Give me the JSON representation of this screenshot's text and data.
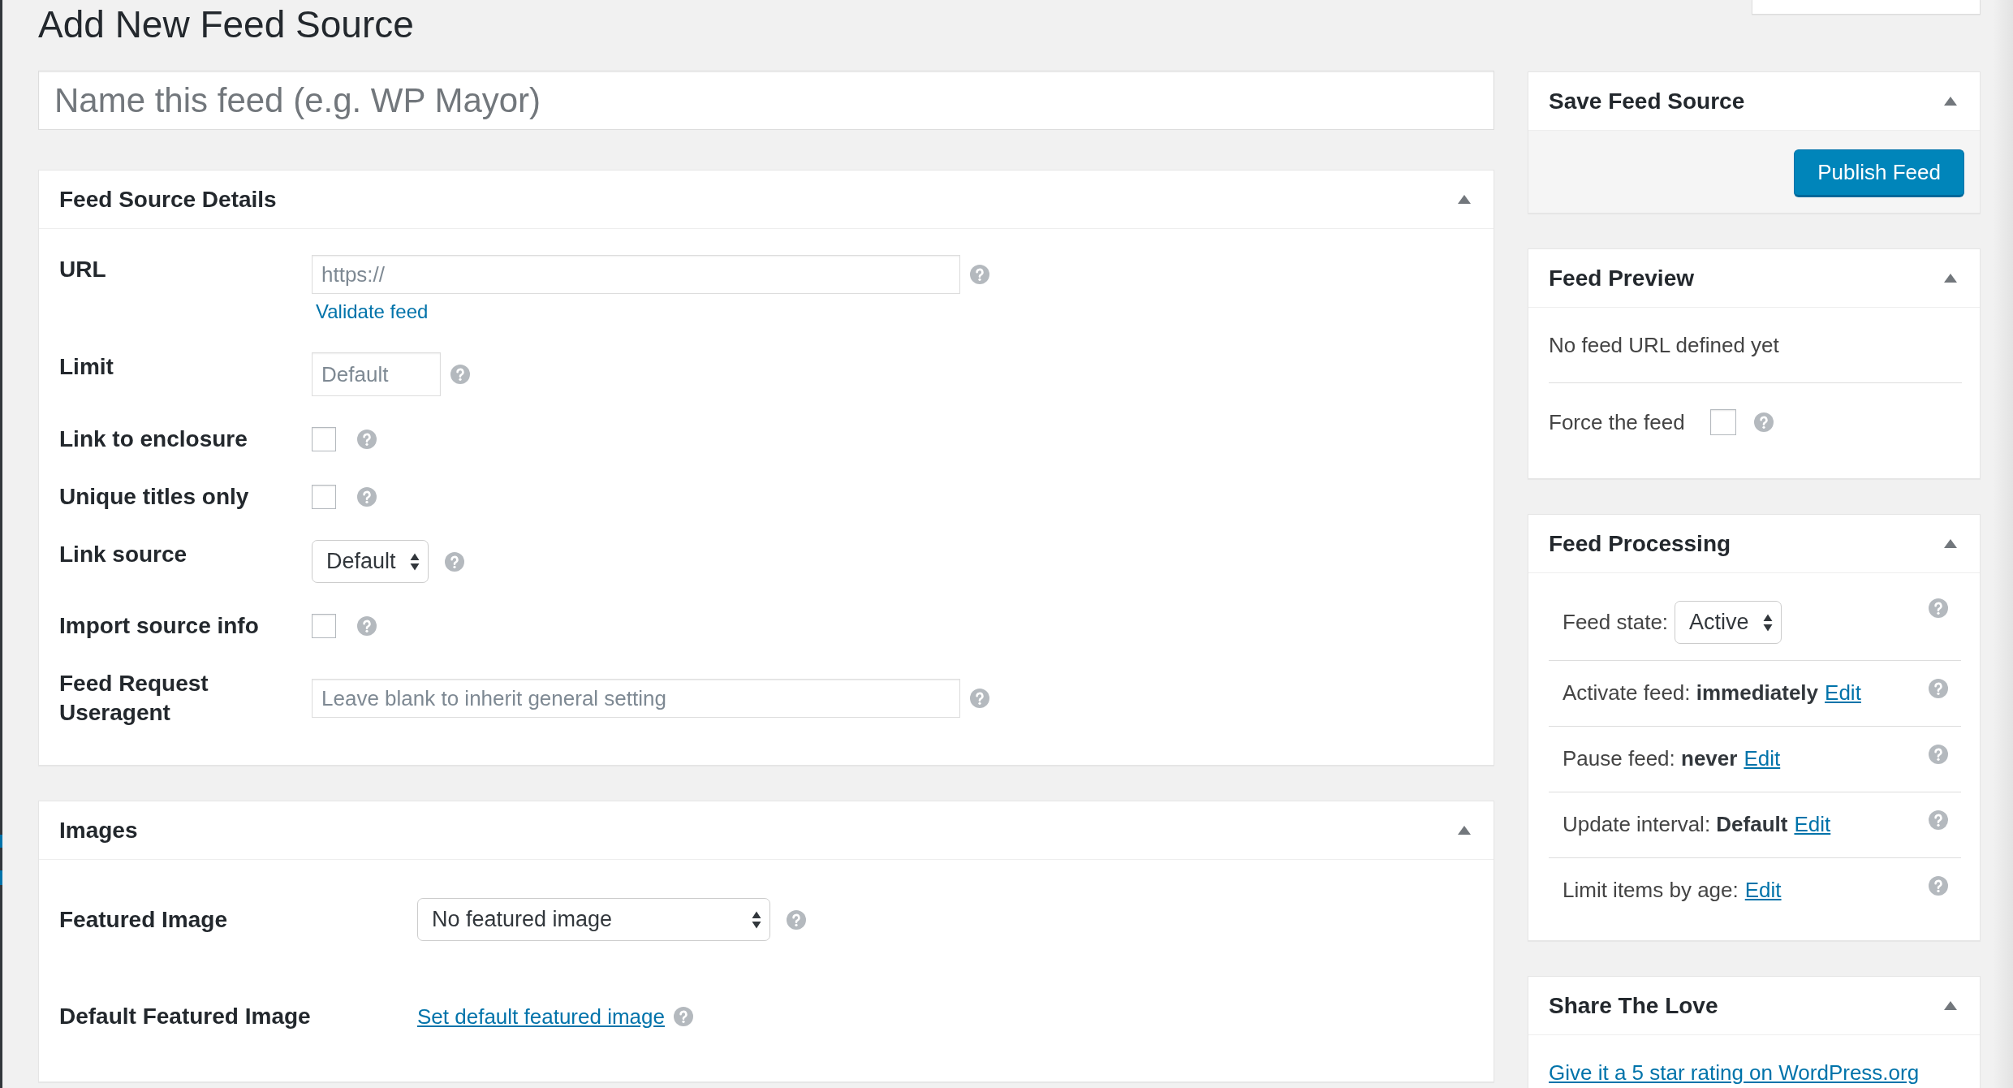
{
  "page_title": "Add New Feed Source",
  "title_field": {
    "placeholder": "Name this feed (e.g. WP Mayor)"
  },
  "main_boxes": [
    {
      "title": "Feed Source Details",
      "fields": [
        {
          "kind": "text",
          "label": "URL",
          "placeholder": "https://",
          "link": "Validate feed"
        },
        {
          "kind": "number",
          "label": "Limit",
          "placeholder": "Default"
        },
        {
          "kind": "checkbox",
          "label": "Link to enclosure",
          "checked": false
        },
        {
          "kind": "checkbox",
          "label": "Unique titles only",
          "checked": false
        },
        {
          "kind": "select",
          "label": "Link source",
          "value": "Default"
        },
        {
          "kind": "checkbox",
          "label": "Import source info",
          "checked": false
        },
        {
          "kind": "text",
          "label": "Feed Request Useragent",
          "placeholder": "Leave blank to inherit general setting"
        }
      ]
    },
    {
      "title": "Images",
      "fields": [
        {
          "kind": "select",
          "label": "Featured Image",
          "value": "No featured image"
        },
        {
          "kind": "link",
          "label": "Default Featured Image",
          "link": "Set default featured image"
        }
      ]
    }
  ],
  "sidebar_boxes": [
    {
      "kind": "publish",
      "title": "Save Feed Source",
      "button": "Publish Feed"
    },
    {
      "kind": "preview",
      "title": "Feed Preview",
      "message": "No feed URL defined yet",
      "option": {
        "label": "Force the feed",
        "checked": false
      }
    },
    {
      "kind": "processing",
      "title": "Feed Processing",
      "state": {
        "label": "Feed state:",
        "value": "Active"
      },
      "rows": [
        {
          "text": "Activate feed: **immediately**",
          "link": "Edit"
        },
        {
          "text": "Pause feed: **never**",
          "link": "Edit"
        },
        {
          "text": "Update interval: **Default**",
          "link": "Edit"
        },
        {
          "text": "Limit items by age:",
          "link": "Edit"
        }
      ]
    },
    {
      "kind": "share",
      "title": "Share The Love",
      "link": "Give it a 5 star rating on WordPress.org"
    }
  ]
}
